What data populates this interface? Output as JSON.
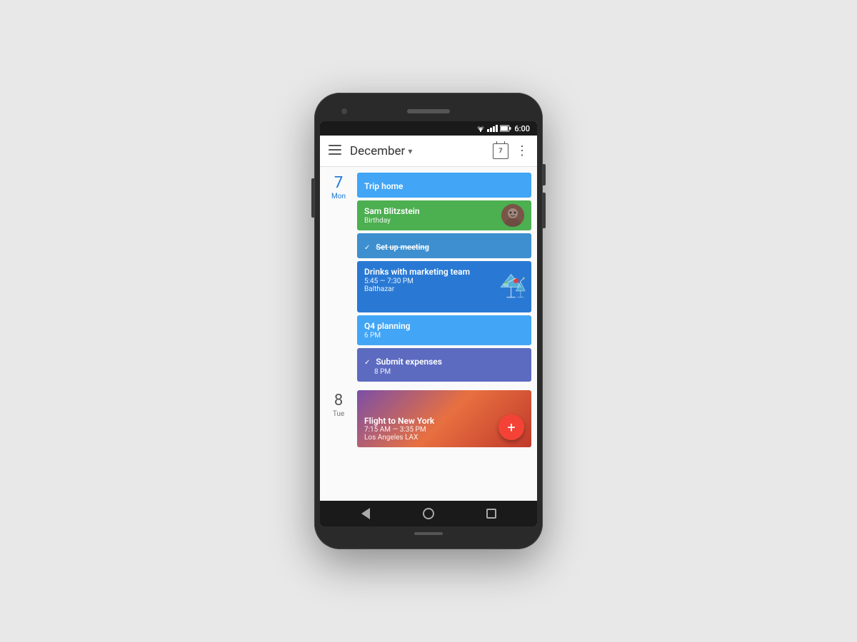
{
  "phone": {
    "status_bar": {
      "time": "6:00"
    },
    "header": {
      "month": "December",
      "menu_label": "☰",
      "more_label": "⋮",
      "day_number": "7"
    },
    "day7": {
      "number": "7",
      "name": "Mon",
      "events": [
        {
          "id": "trip-home",
          "title": "Trip home",
          "type": "normal",
          "color": "blue-light"
        },
        {
          "id": "sam-birthday",
          "title": "Sam Blitzstein",
          "subtitle": "Birthday",
          "type": "birthday",
          "color": "green",
          "has_avatar": true
        },
        {
          "id": "set-up-meeting",
          "title": "Set up meeting",
          "type": "task",
          "color": "blue-medium",
          "is_task": true
        },
        {
          "id": "drinks",
          "title": "Drinks with marketing team",
          "time": "5:45 — 7:30 PM",
          "location": "Balthazar",
          "type": "event",
          "color": "blue-dark",
          "has_cocktail": true
        },
        {
          "id": "q4-planning",
          "title": "Q4 planning",
          "time": "6 PM",
          "type": "event",
          "color": "blue-light"
        },
        {
          "id": "submit-expenses",
          "title": "Submit expenses",
          "time": "8 PM",
          "type": "task",
          "color": "blue-violet",
          "is_task": true
        }
      ]
    },
    "day8": {
      "number": "8",
      "name": "Tue",
      "flight": {
        "title": "Flight to New York",
        "time": "7:15 AM — 3:35 PM",
        "location": "Los Angeles LAX"
      }
    },
    "fab": {
      "label": "+"
    },
    "nav": {
      "back": "",
      "home": "",
      "recent": ""
    }
  }
}
